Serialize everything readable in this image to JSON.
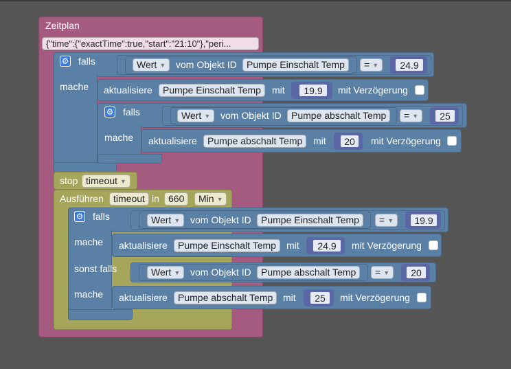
{
  "schedule": {
    "title": "Zeitplan",
    "json_value": "{\"time\":{\"exactTime\":true,\"start\":\"21:10\"},\"peri..."
  },
  "if1": {
    "falls": "falls",
    "mache": "mache",
    "cond": {
      "prop": "Wert",
      "of_object": "vom Objekt ID",
      "object": "Pumpe Einschalt Temp",
      "op": "=",
      "value": "24.9"
    },
    "action": {
      "label": "aktualisiere",
      "object": "Pumpe Einschalt Temp",
      "with": "mit",
      "value": "19.9",
      "delay_label": "mit Verzögerung"
    }
  },
  "if2": {
    "falls": "falls",
    "mache": "mache",
    "cond": {
      "prop": "Wert",
      "of_object": "vom Objekt ID",
      "object": "Pumpe abschalt Temp",
      "op": "=",
      "value": "25"
    },
    "action": {
      "label": "aktualisiere",
      "object": "Pumpe abschalt Temp",
      "with": "mit",
      "value": "20",
      "delay_label": "mit Verzögerung"
    }
  },
  "stop": {
    "label": "stop",
    "var": "timeout"
  },
  "run": {
    "label": "Ausführen",
    "var": "timeout",
    "in": "in",
    "value": "660",
    "unit": "Min"
  },
  "if3": {
    "falls": "falls",
    "mache1": "mache",
    "cond1": {
      "prop": "Wert",
      "of_object": "vom Objekt ID",
      "object": "Pumpe Einschalt Temp",
      "op": "=",
      "value": "19.9"
    },
    "action1": {
      "label": "aktualisiere",
      "object": "Pumpe Einschalt Temp",
      "with": "mit",
      "value": "24.9",
      "delay_label": "mit Verzögerung"
    },
    "sonst_falls": "sonst falls",
    "cond2": {
      "prop": "Wert",
      "of_object": "vom Objekt ID",
      "object": "Pumpe abschalt Temp",
      "op": "=",
      "value": "20"
    },
    "mache2": "mache",
    "action2": {
      "label": "aktualisiere",
      "object": "Pumpe abschalt Temp",
      "with": "mit",
      "value": "25",
      "delay_label": "mit Verzögerung"
    }
  },
  "colors": {
    "schedule": "#a55b80",
    "logic": "#5b80a5",
    "timeouts": "#a5a55b",
    "number": "#5b67a5",
    "background": "#555555"
  }
}
